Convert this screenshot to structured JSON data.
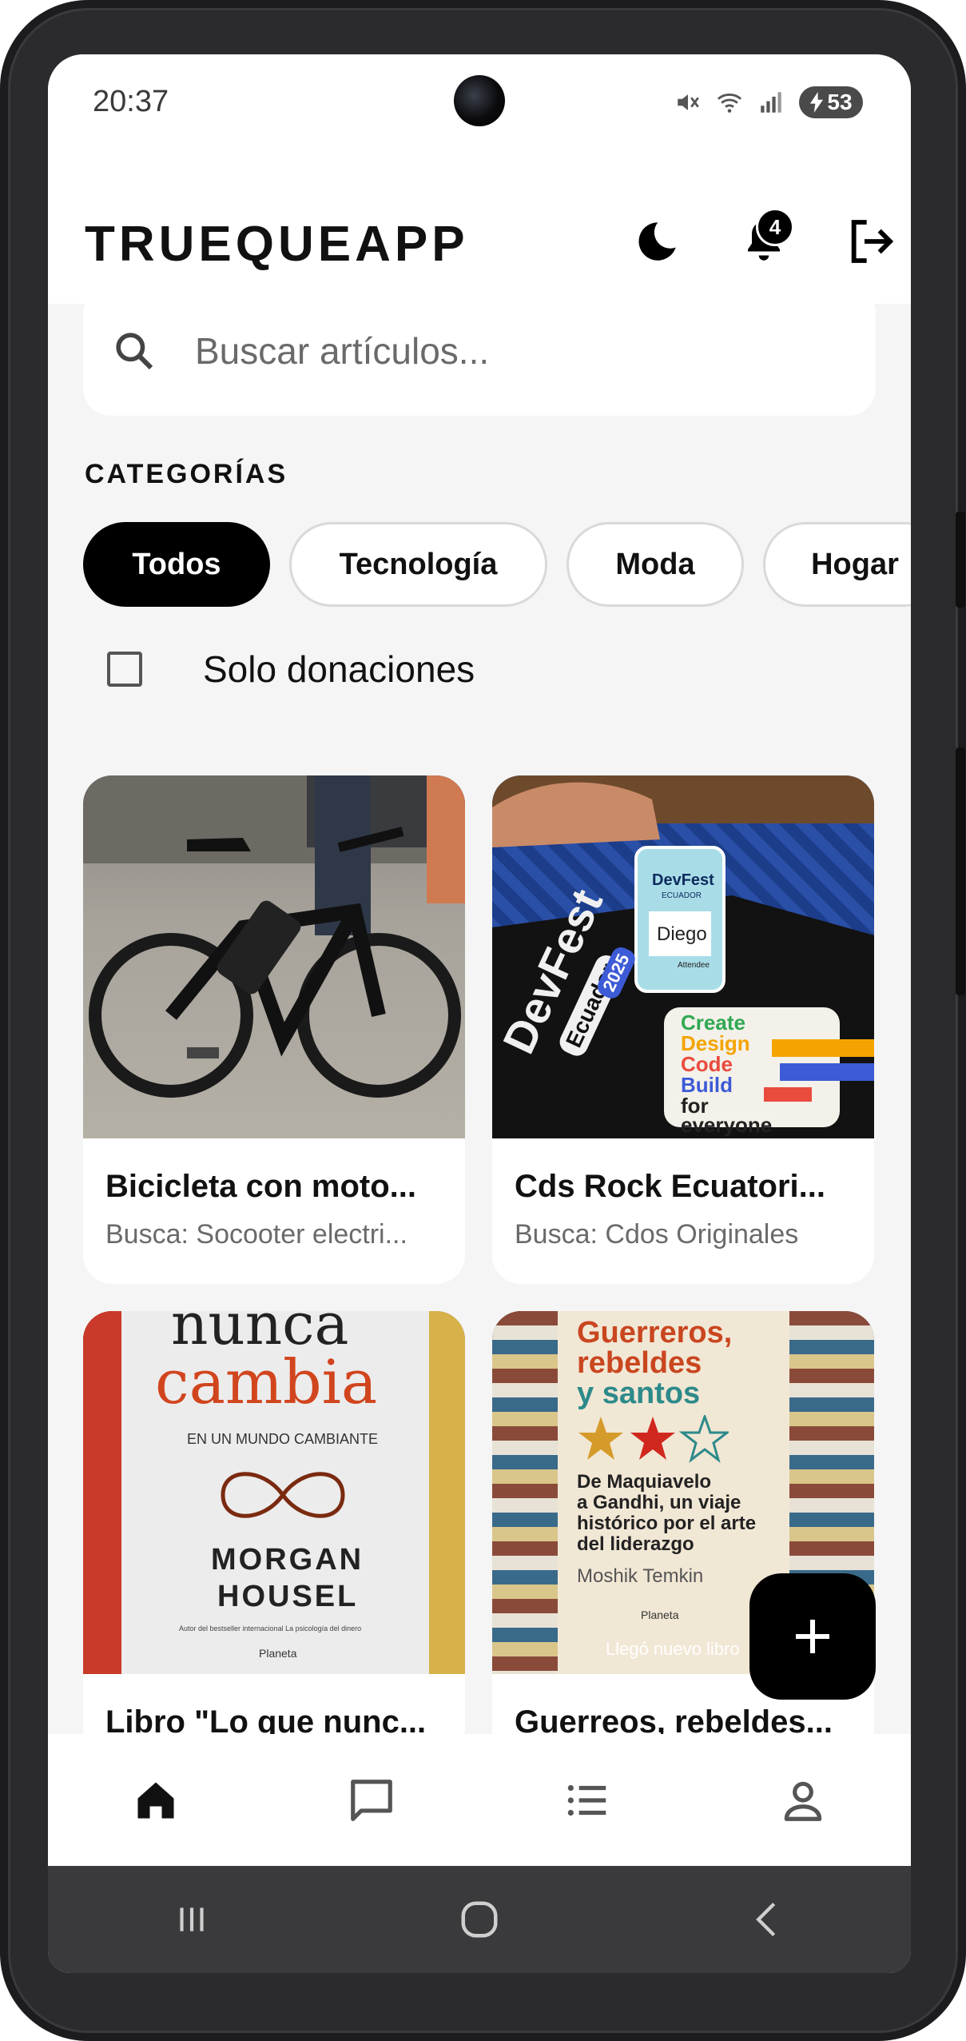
{
  "status_bar": {
    "time": "20:37",
    "battery": "53",
    "icons": [
      "mute-icon",
      "wifi-icon",
      "signal-icon",
      "battery-charging-icon"
    ]
  },
  "app_bar": {
    "title": "TRUEQUEAPP",
    "notification_count": "4",
    "icons": [
      "moon-icon",
      "bell-icon",
      "logout-icon"
    ]
  },
  "search": {
    "placeholder": "Buscar artículos..."
  },
  "categories": {
    "label": "CATEGORÍAS",
    "items": [
      "Todos",
      "Tecnología",
      "Moda",
      "Hogar"
    ],
    "selected": "Todos"
  },
  "donations_filter": {
    "label": "Solo donaciones",
    "checked": false
  },
  "items": [
    {
      "title": "Bicicleta con moto...",
      "subtitle": "Busca: Socooter electri...",
      "image": "electric-bicycle-photo"
    },
    {
      "title": "Cds Rock Ecuatori...",
      "subtitle": "Busca: Cdos Originales",
      "image": "devfest-badge-photo"
    },
    {
      "title": "Libro \"Lo que nunc...",
      "subtitle": "",
      "image": "book-cover-photo"
    },
    {
      "title": "Guerreos, rebeldes...",
      "subtitle": "",
      "image": "book-cover-photo"
    }
  ],
  "book_covers": {
    "book1": {
      "line1": "nunca",
      "line2": "cambia",
      "line3": "EN UN MUNDO CAMBIANTE",
      "author1": "MORGAN",
      "author2": "HOUSEL",
      "publisher": "Planeta",
      "blurb": "Autor del bestseller internacional La psicología del dinero"
    },
    "book2": {
      "line1": "Guerreros,",
      "line2": "rebeldes",
      "line3": "y santos",
      "desc1": "De Maquiavelo",
      "desc2": "a Gandhi, un viaje",
      "desc3": "histórico por el arte",
      "desc4": "del liderazgo",
      "author": "Moshik Temkin",
      "publisher": "Planeta",
      "tagline": "Llegó nuevo libro"
    }
  },
  "badge_photo": {
    "event": "DevFest",
    "event_sub": "ECUADOR",
    "name": "Diego",
    "role": "Attendee",
    "bag_text": "DevFest",
    "bag_sub": "Ecuador",
    "year": "2025",
    "card_lines": [
      "Create",
      "Design",
      "Code",
      "Build",
      "for",
      "everyone"
    ]
  },
  "fab": {
    "icon": "plus-icon"
  },
  "bottom_nav": [
    "home-icon",
    "chat-icon",
    "list-icon",
    "profile-icon"
  ],
  "system_nav": [
    "recents-icon",
    "home-circle-icon",
    "back-icon"
  ],
  "colors": {
    "primary": "#000000",
    "background": "#f5f5f5",
    "surface": "#ffffff",
    "muted_text": "#6a6a6a"
  }
}
